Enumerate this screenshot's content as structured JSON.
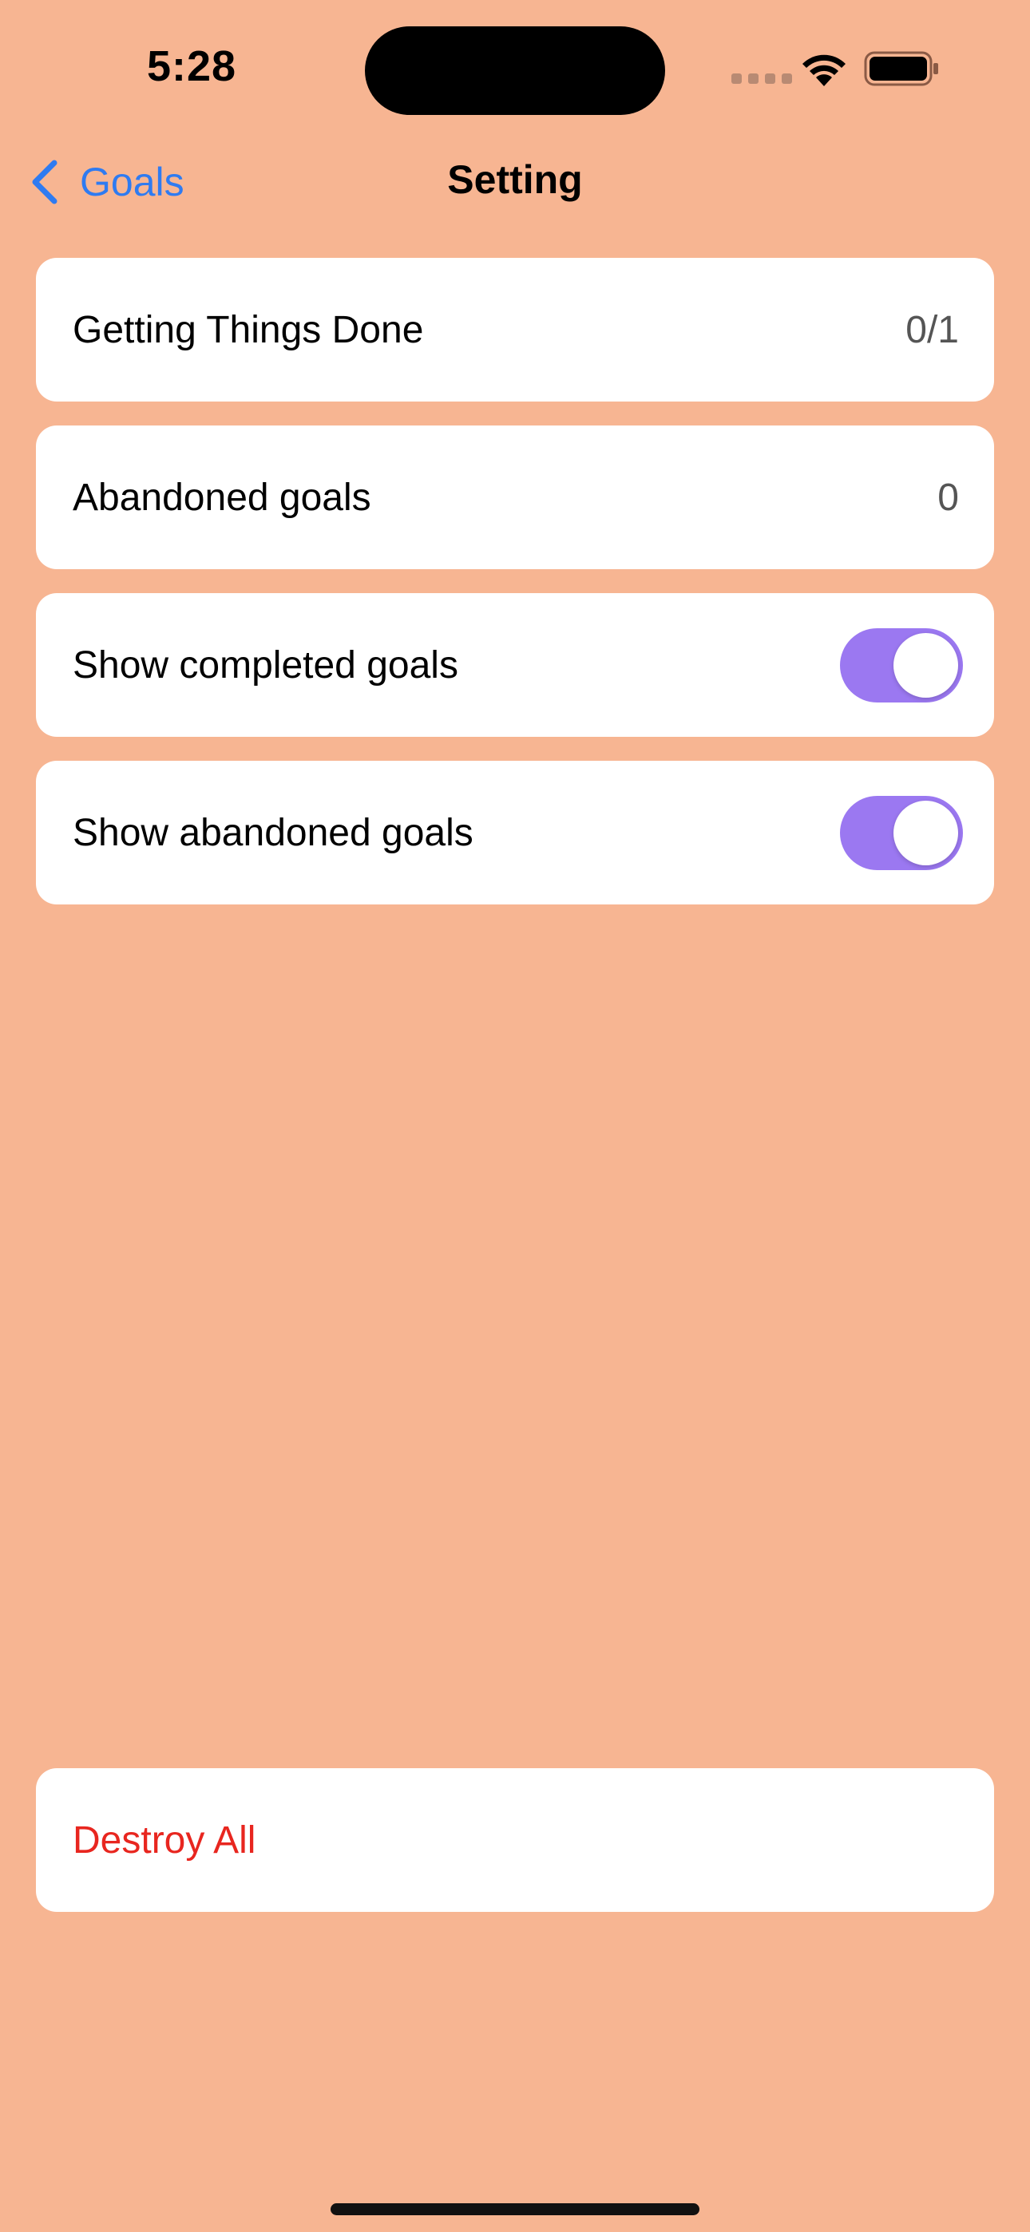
{
  "status_bar": {
    "time": "5:28"
  },
  "nav": {
    "back_label": "Goals",
    "title": "Setting"
  },
  "rows": [
    {
      "label": "Getting Things Done",
      "value": "0/1"
    },
    {
      "label": "Abandoned goals",
      "value": "0"
    },
    {
      "label": "Show completed goals",
      "toggle_on": true
    },
    {
      "label": "Show abandoned goals",
      "toggle_on": true
    }
  ],
  "destroy": {
    "label": "Destroy All"
  },
  "colors": {
    "background": "#F7B592",
    "accent": "#2F7BF1",
    "toggle_on": "#9B78F1",
    "destructive": "#E8261F"
  },
  "icons": [
    "chevron-left-icon",
    "wifi-icon",
    "battery-icon",
    "cellular-signal-icon"
  ]
}
